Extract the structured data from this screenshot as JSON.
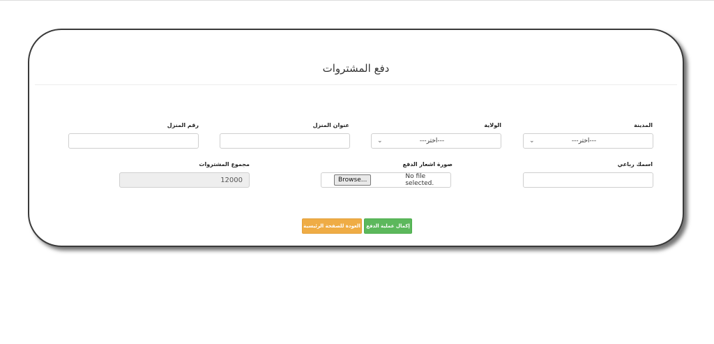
{
  "page": {
    "title": "دفع المشتروات"
  },
  "form": {
    "city": {
      "label": "المدينة",
      "selected": "---اختر---"
    },
    "state": {
      "label": "الولاية",
      "selected": "---اختر---"
    },
    "address": {
      "label": "عنوان المنزل",
      "value": ""
    },
    "house_number": {
      "label": "رقم المنزل",
      "value": ""
    },
    "full_name": {
      "label": "اسمك رباعي",
      "value": ""
    },
    "receipt": {
      "label": "صورة اشعار الدفع",
      "browse_label": "Browse...",
      "status": "No file selected."
    },
    "total": {
      "label": "مجموع المشتروات",
      "value": "12000"
    }
  },
  "actions": {
    "complete_label": "إكمال عملية الدفع",
    "home_label": "العودة للصفحة الرئيسية"
  },
  "colors": {
    "success": "#5cb85c",
    "warning": "#efac45"
  }
}
